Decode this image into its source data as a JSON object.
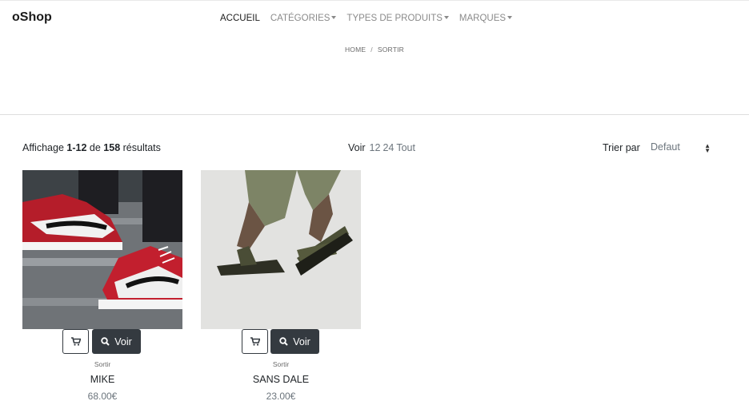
{
  "brand": "oShop",
  "nav": {
    "home": "ACCUEIL",
    "categories": "CATÉGORIES",
    "types": "TYPES DE PRODUITS",
    "brands": "MARQUES"
  },
  "breadcrumb": {
    "home": "HOME",
    "separator": "/",
    "current": "SORTIR"
  },
  "toolbar": {
    "results_prefix": "Affichage",
    "results_range": "1-12",
    "results_of": "de",
    "results_total": "158",
    "results_suffix": "résultats",
    "perpage_label": "Voir",
    "perpage_options": [
      "12",
      "24",
      "Tout"
    ],
    "sort_label": "Trier par",
    "sort_value": "Defaut"
  },
  "products": [
    {
      "category": "Sortir",
      "name": "MIKE",
      "price": "68.00€",
      "view_label": "Voir"
    },
    {
      "category": "Sortir",
      "name": "SANS DALE",
      "price": "23.00€",
      "view_label": "Voir"
    }
  ],
  "colors": {
    "button_dark": "#343a40",
    "muted": "#6c757d",
    "nav_inactive": "#8a8a8a"
  },
  "icons": {
    "cart": "cart-icon",
    "search": "search-icon",
    "caret": "caret-down-icon",
    "sort": "sort-icon"
  }
}
